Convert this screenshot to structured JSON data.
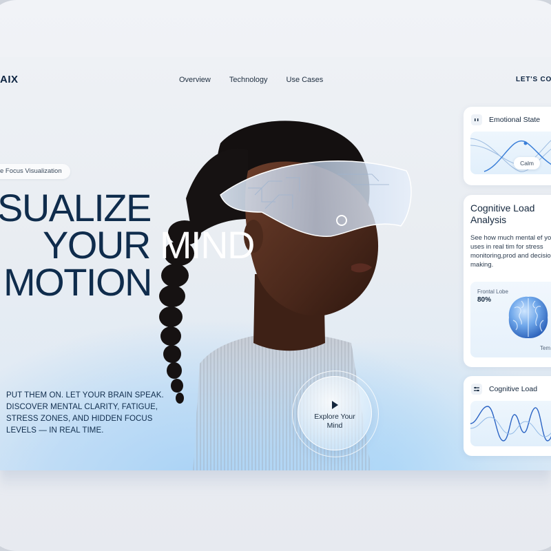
{
  "brand": "AIX",
  "nav": {
    "items": [
      "Overview",
      "Technology",
      "Use Cases"
    ],
    "cta": "LET'S CON"
  },
  "hero": {
    "pill": "e Focus Visualization",
    "headline": {
      "line1": "SUALIZE",
      "line2_dark": "YOUR",
      "line2_light": " MIND",
      "line3": "MOTION"
    },
    "tagline": "PUT THEM ON. LET YOUR BRAIN SPEAK. DISCOVER MENTAL CLARITY, FATIGUE, STRESS ZONES, AND HIDDEN FOCUS LEVELS — IN REAL TIME.",
    "explore": {
      "label_line1": "Explore Your",
      "label_line2": "Mind",
      "icon": "play-icon"
    }
  },
  "cards": {
    "emotional": {
      "title": "Emotional State",
      "badge": "Calm",
      "icon": "emotion-icon"
    },
    "analysis": {
      "title": "Cognitive Load Analysis",
      "description": "See how much mental ef your brain uses in real tim for stress monitoring,prod and decision-making.",
      "region_label": "Frontal Lobe",
      "region_value": "80%",
      "secondary_label": "Tem"
    },
    "load": {
      "title": "Cognitive Load",
      "icon": "waveform-icon"
    }
  },
  "colors": {
    "navy": "#0f2c4c",
    "accent": "#3b7fd8",
    "sky": "#a8d2f6"
  }
}
